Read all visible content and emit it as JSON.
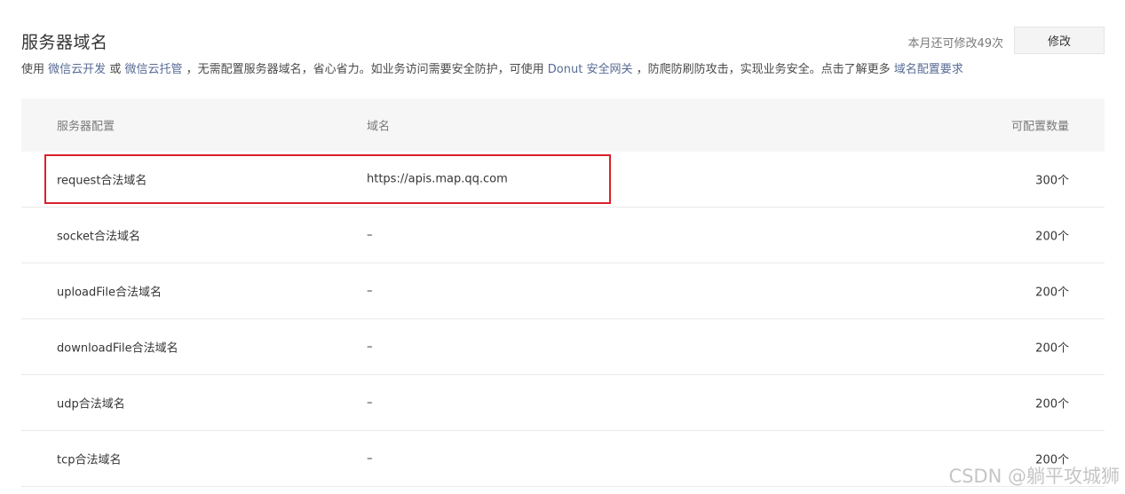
{
  "header": {
    "title": "服务器域名",
    "quota_text": "本月还可修改49次",
    "modify_button": "修改"
  },
  "description": {
    "part1": "使用",
    "link_cloud_dev": "微信云开发",
    "part2": "或",
    "link_cloud_host": "微信云托管",
    "part3": "，无需配置服务器域名，省心省力。如业务访问需要安全防护，可使用",
    "link_donut": "Donut 安全网关",
    "part4": "，防爬防刷防攻击，实现业务安全。点击了解更多",
    "link_requirements": "域名配置要求"
  },
  "table": {
    "headers": [
      "服务器配置",
      "域名",
      "可配置数量"
    ],
    "rows": [
      {
        "name": "request合法域名",
        "domain": "https://apis.map.qq.com",
        "count": "300个"
      },
      {
        "name": "socket合法域名",
        "domain": "–",
        "count": "200个"
      },
      {
        "name": "uploadFile合法域名",
        "domain": "–",
        "count": "200个"
      },
      {
        "name": "downloadFile合法域名",
        "domain": "–",
        "count": "200个"
      },
      {
        "name": "udp合法域名",
        "domain": "–",
        "count": "200个"
      },
      {
        "name": "tcp合法域名",
        "domain": "–",
        "count": "200个"
      }
    ]
  },
  "watermark": "CSDN @躺平攻城狮",
  "colors": {
    "link": "#576b95",
    "highlight_border": "#d9212a",
    "header_bg": "#f6f6f6"
  }
}
